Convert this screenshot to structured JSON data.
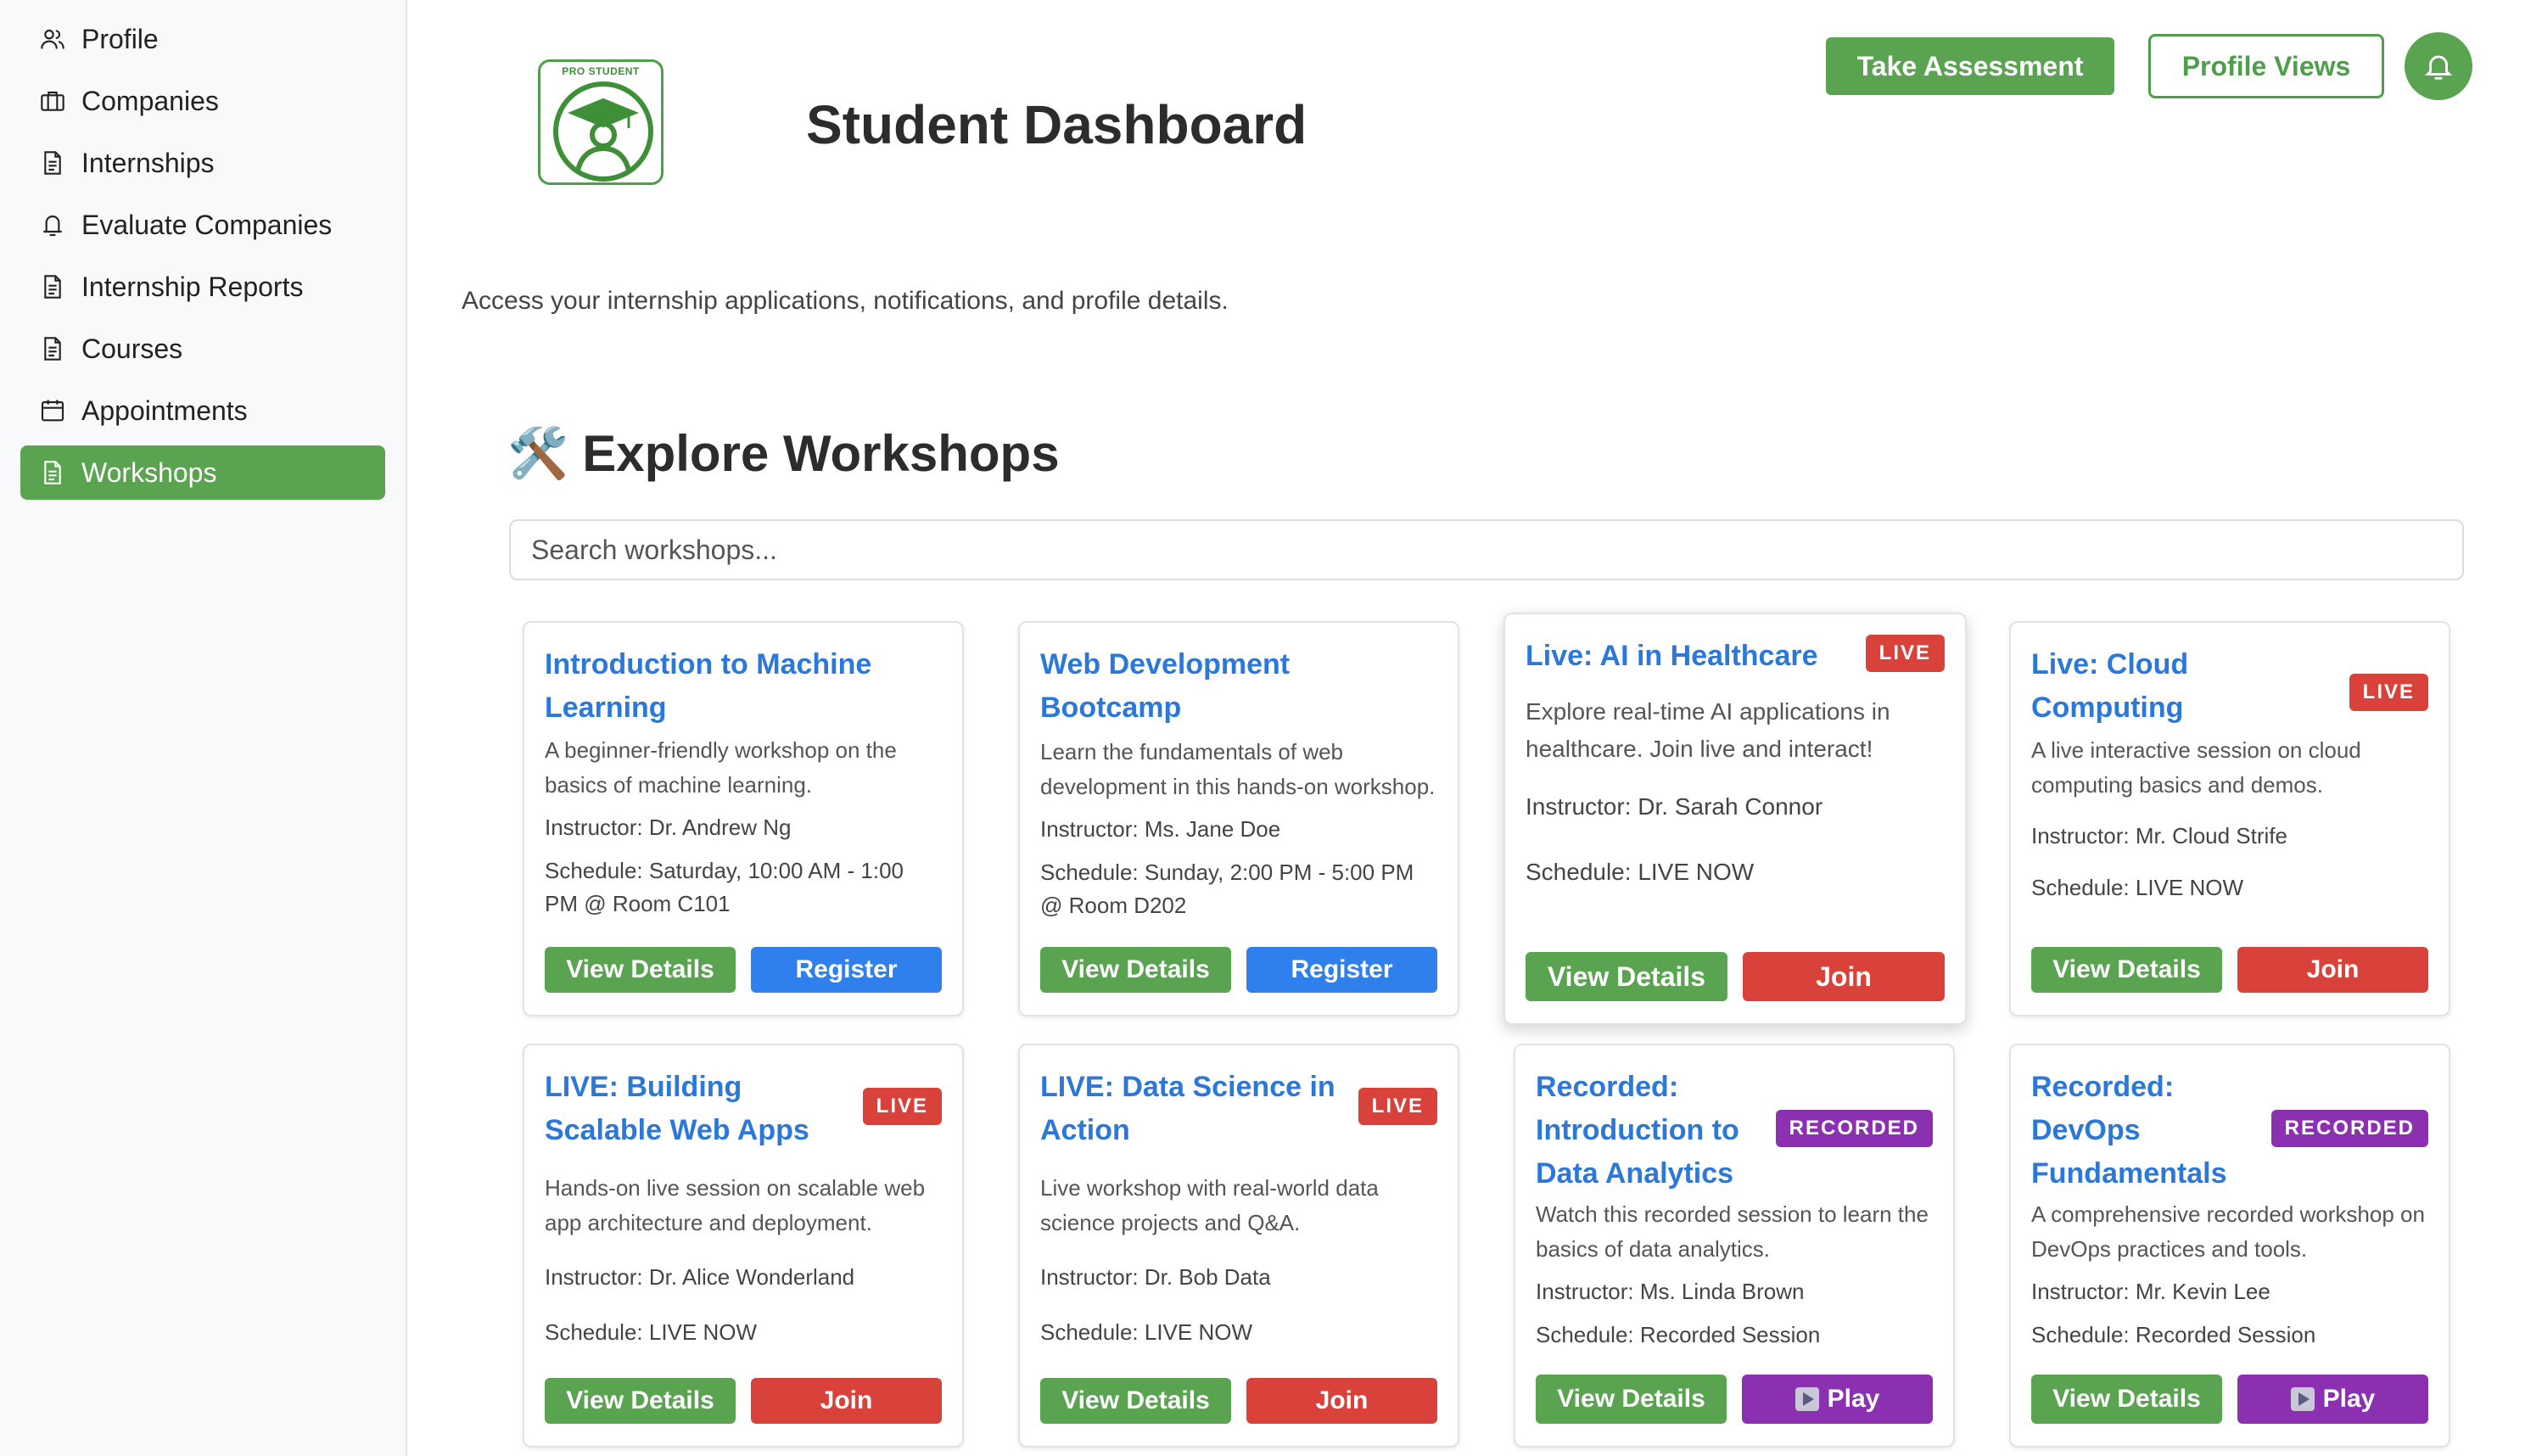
{
  "sidebar": {
    "items": [
      {
        "label": "Profile",
        "icon": "users-icon"
      },
      {
        "label": "Companies",
        "icon": "briefcase-icon"
      },
      {
        "label": "Internships",
        "icon": "document-icon"
      },
      {
        "label": "Evaluate Companies",
        "icon": "bell-icon"
      },
      {
        "label": "Internship Reports",
        "icon": "document-icon"
      },
      {
        "label": "Courses",
        "icon": "document-icon"
      },
      {
        "label": "Appointments",
        "icon": "calendar-icon"
      },
      {
        "label": "Workshops",
        "icon": "document-icon",
        "active": true
      }
    ]
  },
  "header": {
    "logo_text": "PRO STUDENT",
    "title": "Student Dashboard",
    "take_assessment": "Take Assessment",
    "profile_views": "Profile Views",
    "subtitle": "Access your internship applications, notifications, and profile details."
  },
  "workshops": {
    "heading_icon": "🛠️",
    "heading": "Explore Workshops",
    "search_placeholder": "Search workshops...",
    "cards": [
      {
        "title": "Introduction to Machine Learning",
        "badge": "",
        "desc": "A beginner-friendly workshop on the basics of machine learning.",
        "instructor": "Instructor: Dr. Andrew Ng",
        "schedule": "Schedule: Saturday, 10:00 AM - 1:00 PM @ Room C101",
        "details": "View Details",
        "action": "Register"
      },
      {
        "title": "Web Development Bootcamp",
        "badge": "",
        "desc": "Learn the fundamentals of web development in this hands-on workshop.",
        "instructor": "Instructor: Ms. Jane Doe",
        "schedule": "Schedule: Sunday, 2:00 PM - 5:00 PM @ Room D202",
        "details": "View Details",
        "action": "Register"
      },
      {
        "title": "Live: AI in Healthcare",
        "badge": "LIVE",
        "desc": "Explore real-time AI applications in healthcare. Join live and interact!",
        "instructor": "Instructor: Dr. Sarah Connor",
        "schedule": "Schedule: LIVE NOW",
        "details": "View Details",
        "action": "Join"
      },
      {
        "title": "Live: Cloud Computing",
        "badge": "LIVE",
        "desc": "A live interactive session on cloud computing basics and demos.",
        "instructor": "Instructor: Mr. Cloud Strife",
        "schedule": "Schedule: LIVE NOW",
        "details": "View Details",
        "action": "Join"
      },
      {
        "title": "LIVE: Building Scalable Web Apps",
        "badge": "LIVE",
        "desc": "Hands-on live session on scalable web app architecture and deployment.",
        "instructor": "Instructor: Dr. Alice Wonderland",
        "schedule": "Schedule: LIVE NOW",
        "details": "View Details",
        "action": "Join"
      },
      {
        "title": "LIVE: Data Science in Action",
        "badge": "LIVE",
        "desc": "Live workshop with real-world data science projects and Q&A.",
        "instructor": "Instructor: Dr. Bob Data",
        "schedule": "Schedule: LIVE NOW",
        "details": "View Details",
        "action": "Join"
      },
      {
        "title": "Recorded: Introduction to Data Analytics",
        "badge": "RECORDED",
        "desc": "Watch this recorded session to learn the basics of data analytics.",
        "instructor": "Instructor: Ms. Linda Brown",
        "schedule": "Schedule: Recorded Session",
        "details": "View Details",
        "action": "Play"
      },
      {
        "title": "Recorded: DevOps Fundamentals",
        "badge": "RECORDED",
        "desc": "A comprehensive recorded workshop on DevOps practices and tools.",
        "instructor": "Instructor: Mr. Kevin Lee",
        "schedule": "Schedule: Recorded Session",
        "details": "View Details",
        "action": "Play"
      }
    ]
  },
  "colors": {
    "brand_green": "#5aa350",
    "link_blue": "#2b78d8",
    "register_blue": "#2f80ec",
    "live_red": "#d9423a",
    "recorded_purple": "#8a30b0"
  }
}
